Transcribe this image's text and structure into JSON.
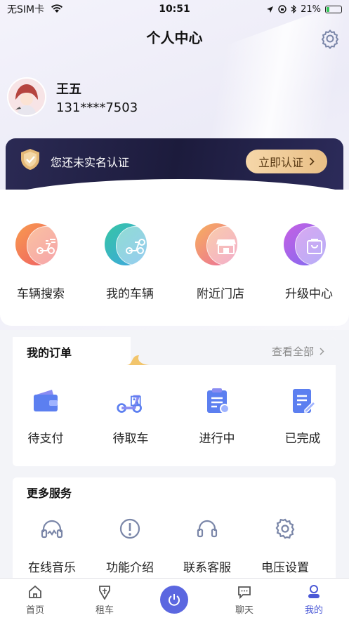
{
  "status_bar": {
    "carrier": "无SIM卡",
    "time": "10:51",
    "battery": "21%"
  },
  "header": {
    "title": "个人中心"
  },
  "profile": {
    "name": "王五",
    "phone": "131****7503"
  },
  "verify": {
    "text": "您还未实名认证",
    "button": "立即认证"
  },
  "quick_actions": [
    {
      "label": "车辆搜索",
      "icon": "scooter-search-icon",
      "color": "#f47a50"
    },
    {
      "label": "我的车辆",
      "icon": "scooter-icon",
      "color": "#3fc6a8"
    },
    {
      "label": "附近门店",
      "icon": "store-icon",
      "color": "#f3a070"
    },
    {
      "label": "升级中心",
      "icon": "bag-icon",
      "color": "#9a6af0"
    }
  ],
  "orders": {
    "title": "我的订单",
    "view_all": "查看全部",
    "items": [
      {
        "label": "待支付",
        "icon": "wallet-icon"
      },
      {
        "label": "待取车",
        "icon": "scooter-qr-icon"
      },
      {
        "label": "进行中",
        "icon": "clipboard-icon"
      },
      {
        "label": "已完成",
        "icon": "edit-doc-icon"
      }
    ]
  },
  "services": {
    "title": "更多服务",
    "items": [
      {
        "label": "在线音乐",
        "icon": "headphones-icon"
      },
      {
        "label": "功能介绍",
        "icon": "info-icon"
      },
      {
        "label": "联系客服",
        "icon": "headset-icon"
      },
      {
        "label": "电压设置",
        "icon": "gear-icon"
      }
    ]
  },
  "tabbar": [
    {
      "label": "首页",
      "icon": "home-icon"
    },
    {
      "label": "租车",
      "icon": "rent-icon"
    },
    {
      "label": "",
      "icon": "power-icon"
    },
    {
      "label": "聊天",
      "icon": "chat-icon"
    },
    {
      "label": "我的",
      "icon": "user-icon",
      "active": true
    }
  ],
  "colors": {
    "accent": "#4a58d6",
    "gold": "#e9bf86",
    "banner": "#1c1b3c"
  }
}
